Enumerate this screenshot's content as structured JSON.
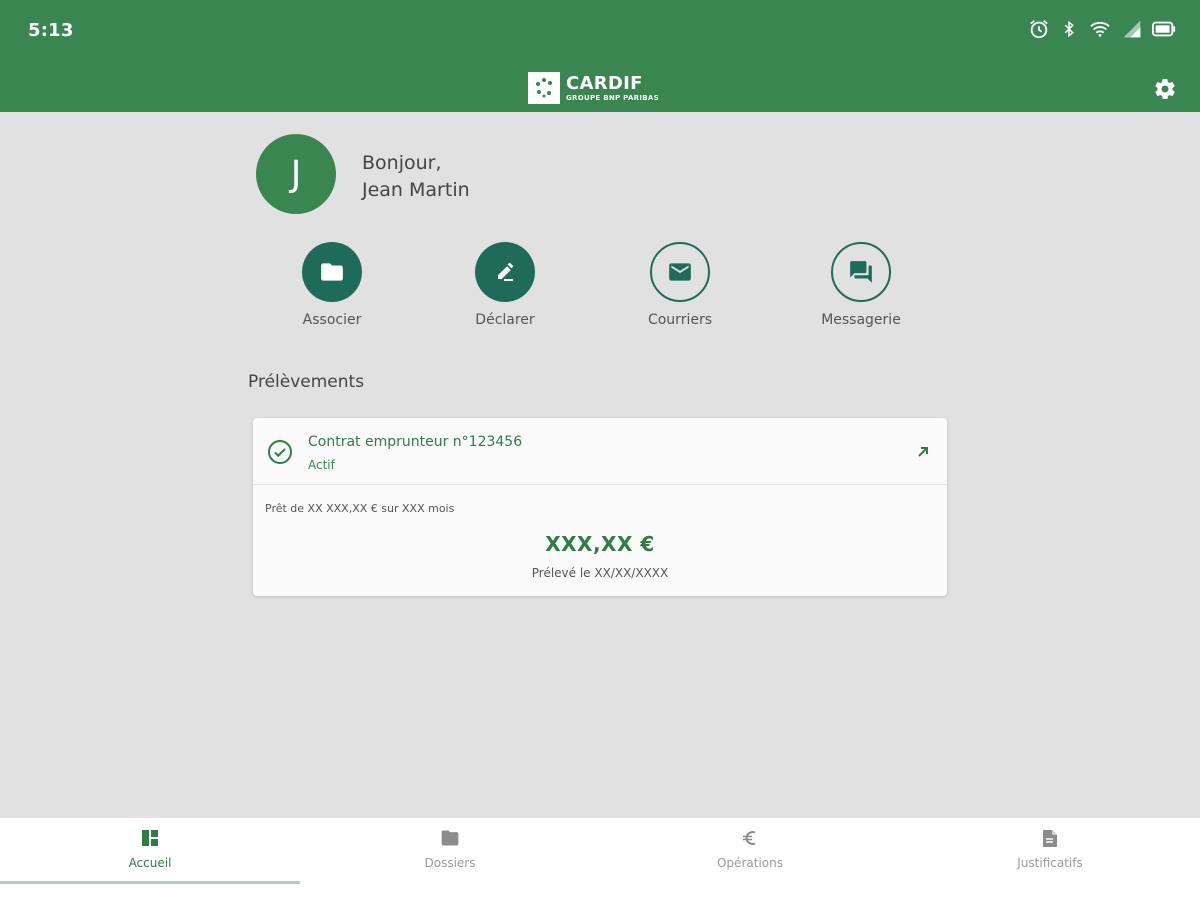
{
  "status_bar": {
    "time": "5:13",
    "icons": [
      "alarm-icon",
      "bluetooth-icon",
      "wifi-icon",
      "signal-icon",
      "battery-icon"
    ]
  },
  "header": {
    "logo_name": "CARDIF",
    "logo_sub": "GROUPE BNP PARIBAS",
    "settings_icon": "gear-icon"
  },
  "user": {
    "initial": "J",
    "greeting": "Bonjour,",
    "name": "Jean Martin"
  },
  "actions": [
    {
      "label": "Associer",
      "icon": "folder-icon",
      "style": "filled"
    },
    {
      "label": "Déclarer",
      "icon": "pencil-icon",
      "style": "filled"
    },
    {
      "label": "Courriers",
      "icon": "mail-icon",
      "style": "outline"
    },
    {
      "label": "Messagerie",
      "icon": "chat-icon",
      "style": "outline"
    }
  ],
  "section": {
    "title": "Prélèvements"
  },
  "contract": {
    "title": "Contrat emprunteur n°123456",
    "status": "Actif",
    "loan_description": "Prêt de XX XXX,XX € sur XXX mois",
    "amount": "XXX,XX €",
    "debit_date": "Prélevé le XX/XX/XXXX"
  },
  "bottom_nav": [
    {
      "label": "Accueil",
      "icon": "dashboard-icon",
      "active": true
    },
    {
      "label": "Dossiers",
      "icon": "folder-icon",
      "active": false
    },
    {
      "label": "Opérations",
      "icon": "euro-icon",
      "active": false
    },
    {
      "label": "Justificatifs",
      "icon": "document-icon",
      "active": false
    }
  ],
  "colors": {
    "brand_green": "#3a8650",
    "action_teal": "#1f6b5a",
    "background": "#e1e1e1"
  }
}
